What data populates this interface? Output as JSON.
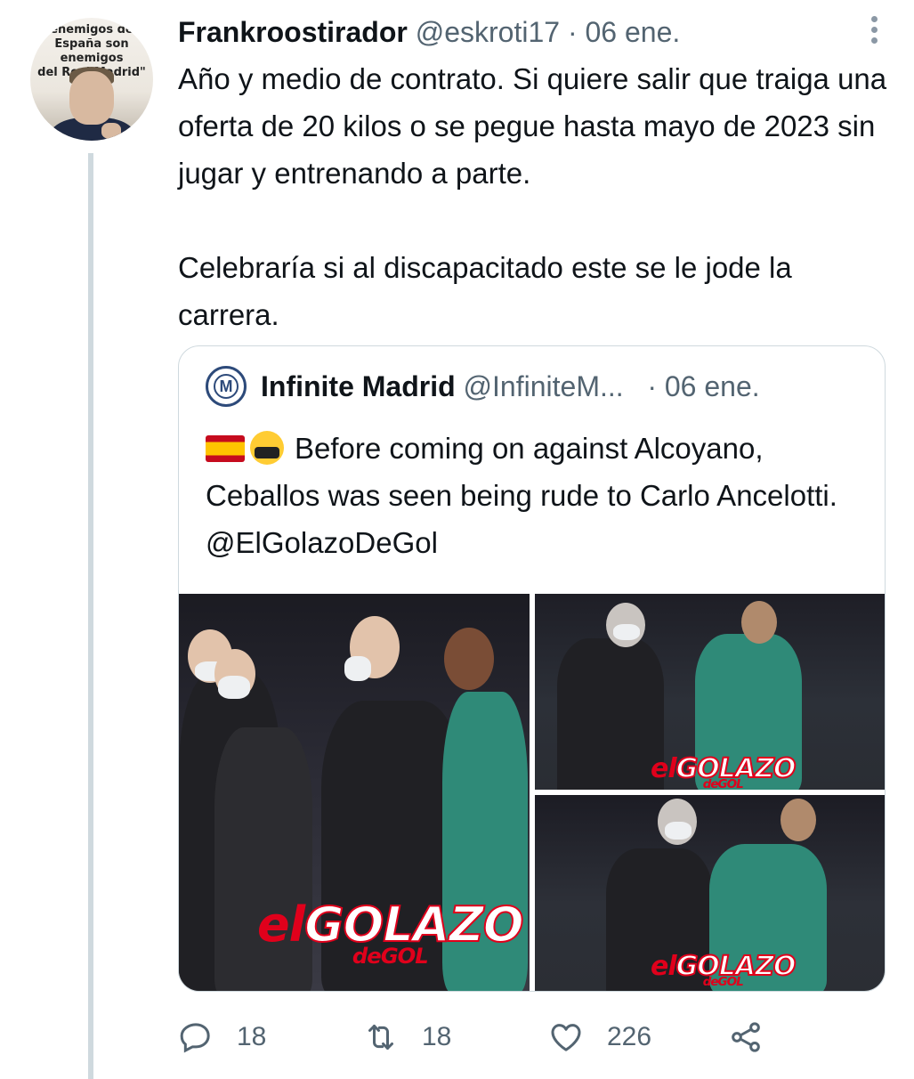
{
  "tweet": {
    "author_name": "Frankroostirador",
    "author_handle": "@eskroti17",
    "separator": "·",
    "date": "06 ene.",
    "avatar_caption": [
      "enemigos de",
      "España son enemigos",
      "del Real Madrid\""
    ],
    "text_paragraphs": [
      "Año y medio de contrato. Si quiere salir que traiga una oferta de 20 kilos o se pegue hasta mayo de 2023 sin jugar y entrenando a parte.",
      "Celebraría si al discapacitado este se le jode la carrera."
    ],
    "more_icon": "ellipsis-vertical-icon"
  },
  "quoted": {
    "author_name": "Infinite Madrid",
    "author_handle": "@InfiniteM...",
    "separator": "·",
    "date": "06 ene.",
    "avatar_mark": "M",
    "text": "Before coming on against Alcoyano, Ceballos was seen being rude to Carlo Ancelotti. @ElGolazoDeGol",
    "emoji_flag": "spain-flag-icon",
    "emoji_face": "face-with-symbols-on-mouth-icon",
    "media_watermark": {
      "el": "el",
      "golazo": "GOLAZO",
      "degol": "deGOL"
    }
  },
  "actions": {
    "reply": {
      "icon": "reply-icon",
      "count": "18"
    },
    "retweet": {
      "icon": "retweet-icon",
      "count": "18"
    },
    "like": {
      "icon": "heart-icon",
      "count": "226"
    },
    "share": {
      "icon": "share-icon"
    }
  },
  "colors": {
    "text": "#0f1419",
    "muted": "#536471",
    "border": "#cfd9de",
    "thread": "#cfd9de",
    "watermark_red": "#e0001b"
  }
}
